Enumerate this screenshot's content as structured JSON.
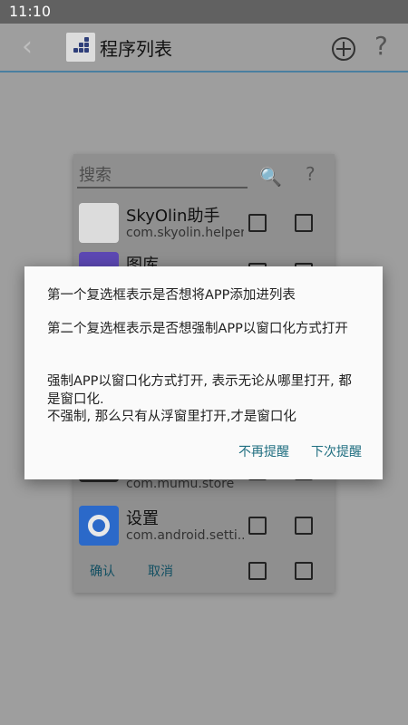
{
  "status_bar": {
    "time": "11:10"
  },
  "app_bar": {
    "title": "程序列表",
    "back_icon": "chevron-left-icon",
    "add_icon": "add-circle-icon",
    "help_icon": "help-icon"
  },
  "list_dialog": {
    "search_placeholder": "搜索",
    "items": [
      {
        "name": "SkyOlin助手",
        "package": "com.skyolin.helper",
        "icon": "skyolin-icon"
      },
      {
        "name": "图库",
        "package": "",
        "icon": "gallery-icon"
      },
      {
        "name": "",
        "package": "com.mumu.store",
        "icon": "mumu-store-icon"
      },
      {
        "name": "设置",
        "package": "com.android.setti...",
        "icon": "settings-gear-icon"
      }
    ],
    "confirm_label": "确认",
    "cancel_label": "取消"
  },
  "tip_dialog": {
    "line1": "第一个复选框表示是否想将APP添加进列表",
    "line2": "第二个复选框表示是否想强制APP以窗口化方式打开",
    "line3": "强制APP以窗口化方式打开, 表示无论从哪里打开, 都是窗口化.",
    "line4": "不强制, 那么只有从浮窗里打开,才是窗口化",
    "dont_remind_label": "不再提醒",
    "remind_next_label": "下次提醒"
  }
}
